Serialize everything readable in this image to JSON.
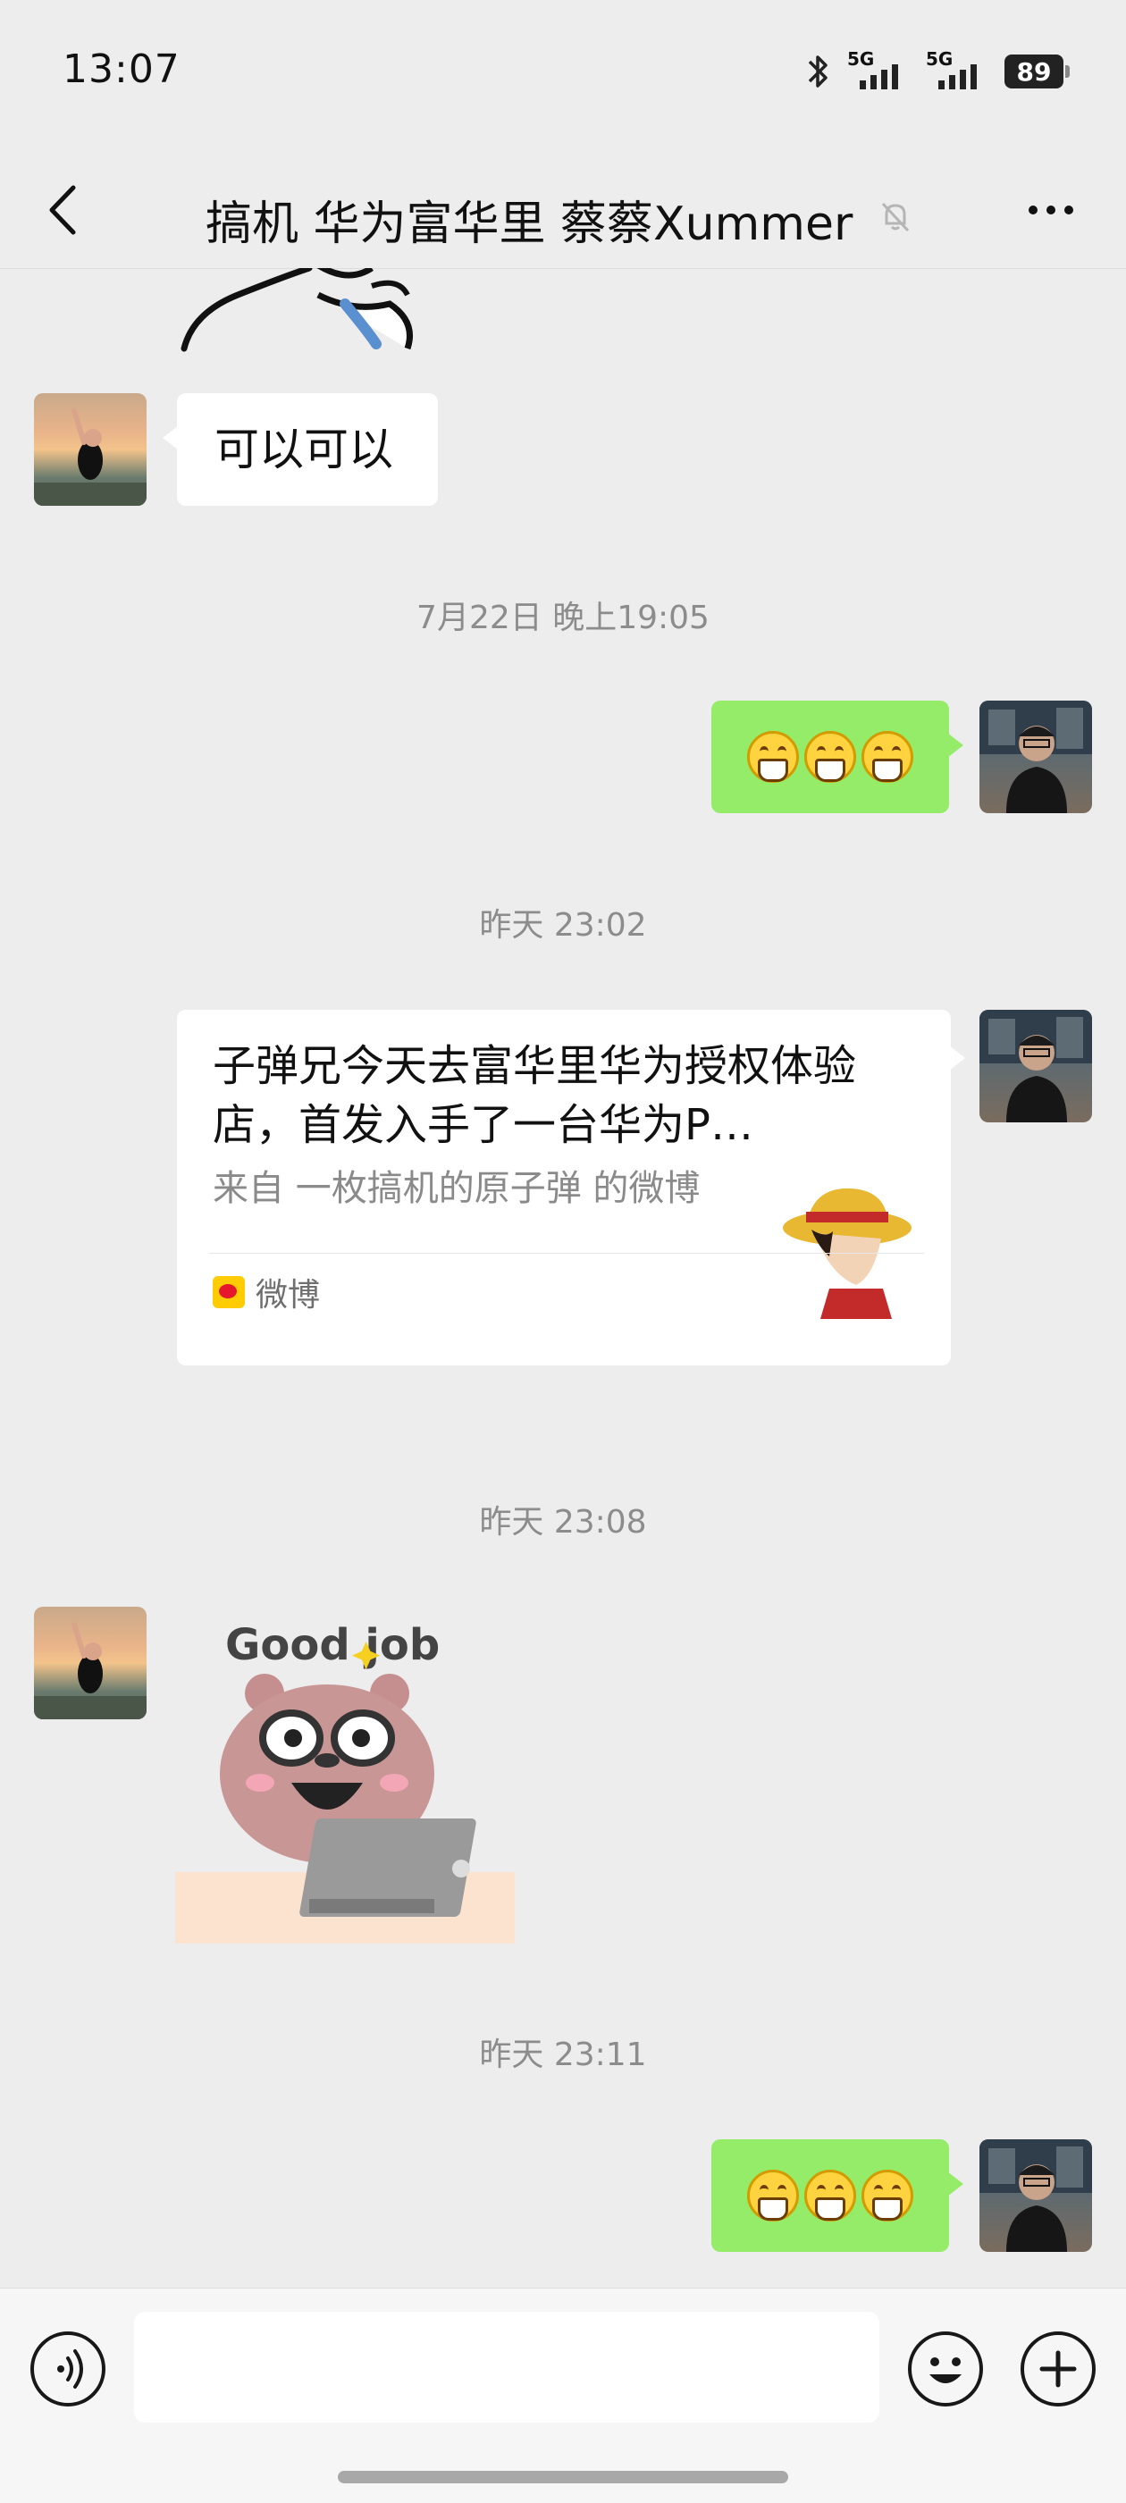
{
  "status_bar": {
    "time": "13:07",
    "signal_label_1": "5G",
    "signal_label_2": "5G",
    "battery": "89",
    "icons": [
      "bluetooth-icon",
      "signal-5g-icon",
      "signal-5g-icon",
      "battery-icon"
    ]
  },
  "header": {
    "title": "搞机 华为富华里 蔡蔡Xummer",
    "icons": [
      "back-arrow-icon",
      "mute-bell-icon",
      "more-dots-icon"
    ]
  },
  "messages": [
    {
      "type": "sticker",
      "sender": "other",
      "description_icon": "cartoon-sticker-icon"
    },
    {
      "type": "text",
      "sender": "other",
      "text": "可以可以"
    },
    {
      "type": "timestamp",
      "text": "7月22日 晚上19:05"
    },
    {
      "type": "emoji",
      "sender": "me",
      "emoji": "grinning-face-icon",
      "count": 3
    },
    {
      "type": "timestamp",
      "text": "昨天 23:02"
    },
    {
      "type": "link_card",
      "sender": "me",
      "title": "子弹兄今天去富华里华为授权体验店，首发入手了一台华为P…",
      "subtitle": "来自 一枚搞机的原子弹 的微博",
      "source": "微博",
      "thumbnail_icon": "straw-hat-character-icon",
      "source_icon": "weibo-icon"
    },
    {
      "type": "timestamp",
      "text": "昨天 23:08"
    },
    {
      "type": "sticker",
      "sender": "other",
      "caption": "Good job",
      "description_icon": "bear-laptop-sticker-icon"
    },
    {
      "type": "timestamp",
      "text": "昨天 23:11"
    },
    {
      "type": "emoji",
      "sender": "me",
      "emoji": "grinning-face-icon",
      "count": 3
    }
  ],
  "input_bar": {
    "input_value": "",
    "icons": [
      "voice-icon",
      "emoji-icon",
      "plus-icon"
    ]
  },
  "colors": {
    "background": "#ededed",
    "my_bubble": "#95ec69",
    "other_bubble": "#ffffff",
    "timestamp_text": "#8c8c8c"
  }
}
